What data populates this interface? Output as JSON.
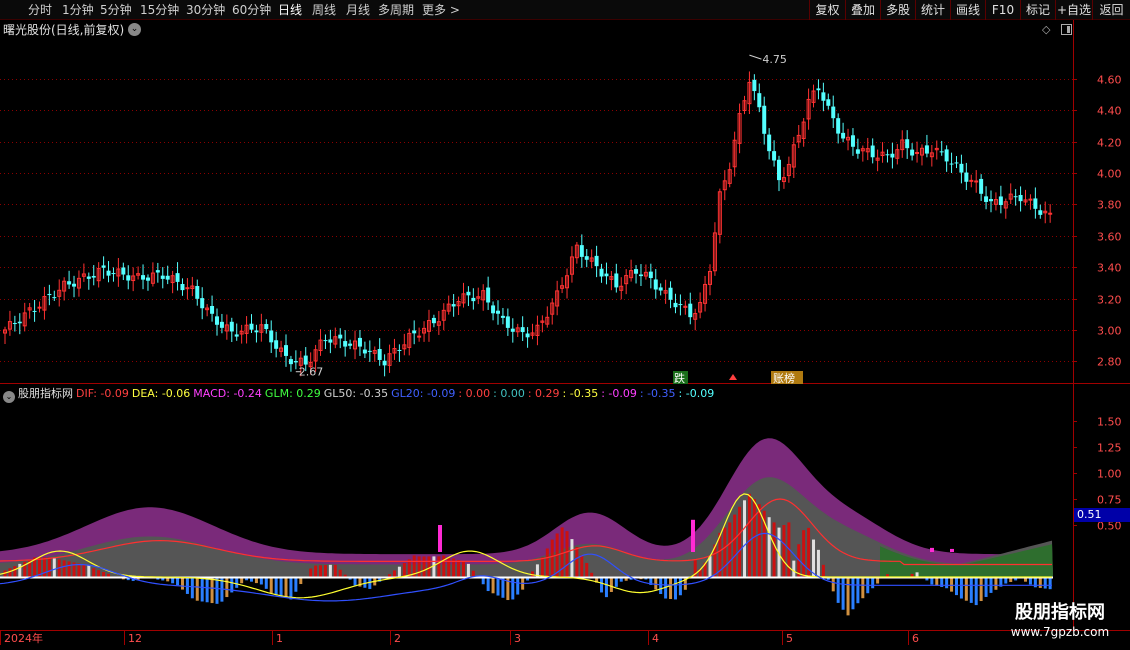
{
  "toolbar": {
    "periods": [
      "分时",
      "1分钟",
      "5分钟",
      "15分钟",
      "30分钟",
      "60分钟",
      "日线",
      "周线",
      "月线",
      "多周期",
      "更多 >"
    ],
    "active_period": "日线",
    "buttons": [
      "复权",
      "叠加",
      "多股",
      "统计",
      "画线",
      "F10",
      "标记",
      "+自选",
      "返回"
    ]
  },
  "main_chart": {
    "title": "曙光股份(日线,前复权)",
    "high_label": "4.75",
    "low_label": "2.67",
    "y_ticks": [
      "4.60",
      "4.40",
      "4.20",
      "4.00",
      "3.80",
      "3.60",
      "3.40",
      "3.20",
      "3.00",
      "2.80"
    ],
    "markers": [
      "跌",
      "账榜"
    ],
    "colors": {
      "up": "#ff3232",
      "down": "#54ffff",
      "grid": "#8b0000"
    }
  },
  "indicator": {
    "name": "股朋指标网",
    "values": [
      {
        "text": "DIF: -0.09",
        "color": "#ff4040"
      },
      {
        "text": "DEA: -0.06",
        "color": "#ffff40"
      },
      {
        "text": "MACD: -0.24",
        "color": "#ff40ff"
      },
      {
        "text": "GLM: 0.29",
        "color": "#40ff40"
      },
      {
        "text": "GL50: -0.35",
        "color": "#d0d0d0"
      },
      {
        "text": "GL20: -0.09",
        "color": "#4060ff"
      },
      {
        "text": ": 0.00",
        "color": "#ff4040"
      },
      {
        "text": ": 0.00",
        "color": "#40c0c0"
      },
      {
        "text": ": 0.29",
        "color": "#ff4040"
      },
      {
        "text": ": -0.35",
        "color": "#ffff40"
      },
      {
        "text": ": -0.09",
        "color": "#ff40ff"
      },
      {
        "text": ": -0.35",
        "color": "#4060ff"
      },
      {
        "text": ": -0.09",
        "color": "#54ffff"
      }
    ],
    "y_ticks": [
      "1.50",
      "1.25",
      "1.00",
      "0.75",
      "0.50"
    ],
    "current_value": "0.51"
  },
  "time_axis": [
    "2024年",
    "12",
    "1",
    "2",
    "3",
    "4",
    "5",
    "6"
  ],
  "watermark": {
    "line1": "股朋指标网",
    "line2": "www.7gpzb.com"
  },
  "chart_data": {
    "type": "candlestick",
    "title": "曙光股份(日线,前复权)",
    "ylim": [
      2.65,
      4.75
    ],
    "high": 4.75,
    "low": 2.67,
    "month_labels": [
      "2024年",
      "12",
      "1",
      "2",
      "3",
      "4",
      "5",
      "6"
    ],
    "close_path": [
      [
        0,
        3.0
      ],
      [
        12,
        3.28
      ],
      [
        20,
        3.38
      ],
      [
        27,
        3.33
      ],
      [
        32,
        3.35
      ],
      [
        38,
        3.25
      ],
      [
        42,
        3.08
      ],
      [
        46,
        2.98
      ],
      [
        52,
        3.02
      ],
      [
        57,
        2.82
      ],
      [
        61,
        2.78
      ],
      [
        65,
        2.95
      ],
      [
        69,
        2.92
      ],
      [
        73,
        2.88
      ],
      [
        77,
        2.8
      ],
      [
        82,
        2.95
      ],
      [
        87,
        3.05
      ],
      [
        92,
        3.2
      ],
      [
        97,
        3.22
      ],
      [
        101,
        3.05
      ],
      [
        105,
        2.97
      ],
      [
        108,
        3.0
      ],
      [
        112,
        3.22
      ],
      [
        116,
        3.52
      ],
      [
        120,
        3.4
      ],
      [
        124,
        3.28
      ],
      [
        128,
        3.38
      ],
      [
        131,
        3.32
      ],
      [
        134,
        3.22
      ],
      [
        137,
        3.15
      ],
      [
        139,
        3.1
      ],
      [
        141,
        3.15
      ],
      [
        143,
        3.4
      ],
      [
        145,
        3.85
      ],
      [
        147,
        4.05
      ],
      [
        149,
        4.35
      ],
      [
        151,
        4.6
      ],
      [
        153,
        4.4
      ],
      [
        155,
        4.15
      ],
      [
        157,
        3.95
      ],
      [
        159,
        4.05
      ],
      [
        161,
        4.25
      ],
      [
        163,
        4.45
      ],
      [
        165,
        4.55
      ],
      [
        167,
        4.4
      ],
      [
        170,
        4.22
      ],
      [
        173,
        4.15
      ],
      [
        176,
        4.12
      ],
      [
        179,
        4.1
      ],
      [
        182,
        4.18
      ],
      [
        185,
        4.12
      ],
      [
        188,
        4.15
      ],
      [
        191,
        4.1
      ],
      [
        194,
        4.0
      ],
      [
        197,
        3.92
      ],
      [
        200,
        3.8
      ],
      [
        203,
        3.83
      ],
      [
        206,
        3.85
      ],
      [
        209,
        3.78
      ],
      [
        212,
        3.72
      ]
    ],
    "indicator_series": [
      "DIF",
      "DEA",
      "MACD",
      "GLM",
      "GL50",
      "GL20"
    ],
    "indicator_ylim": [
      -0.6,
      1.9
    ]
  }
}
